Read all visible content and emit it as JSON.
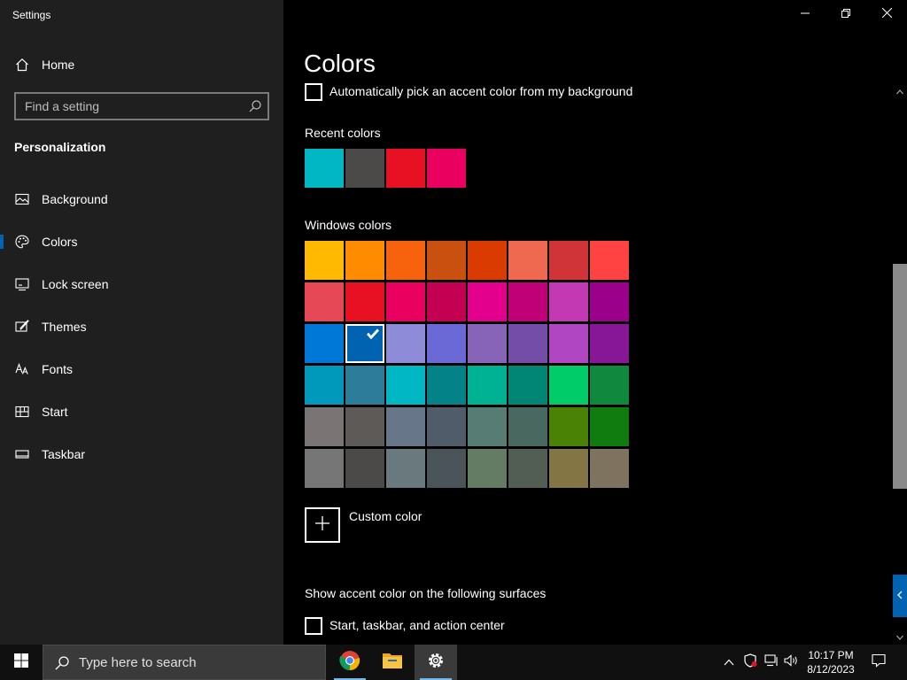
{
  "window": {
    "title": "Settings",
    "minimize_label": "Minimize",
    "restore_label": "Restore",
    "close_label": "Close"
  },
  "sidebar": {
    "home": "Home",
    "search_placeholder": "Find a setting",
    "section": "Personalization",
    "items": [
      {
        "label": "Background",
        "icon": "picture-icon"
      },
      {
        "label": "Colors",
        "icon": "palette-icon",
        "active": true
      },
      {
        "label": "Lock screen",
        "icon": "lock-screen-icon"
      },
      {
        "label": "Themes",
        "icon": "brush-icon"
      },
      {
        "label": "Fonts",
        "icon": "font-icon"
      },
      {
        "label": "Start",
        "icon": "start-icon"
      },
      {
        "label": "Taskbar",
        "icon": "taskbar-icon"
      }
    ]
  },
  "content": {
    "title": "Colors",
    "auto_pick_label": "Automatically pick an accent color from my background",
    "recent_heading": "Recent colors",
    "recent_colors": [
      "#00b7c3",
      "#4c4a48",
      "#e81123",
      "#ea005e"
    ],
    "windows_heading": "Windows colors",
    "windows_colors": [
      [
        "#ffb900",
        "#ff8c00",
        "#f7630c",
        "#ca5010",
        "#da3b01",
        "#ef6950",
        "#d13438",
        "#ff4343"
      ],
      [
        "#e74856",
        "#e81123",
        "#ea005e",
        "#c30052",
        "#e3008c",
        "#bf0077",
        "#c239b3",
        "#9a0089"
      ],
      [
        "#0078d7",
        "#0063b1",
        "#8e8cd8",
        "#6b69d6",
        "#8764b8",
        "#744da9",
        "#b146c2",
        "#881798"
      ],
      [
        "#0099bc",
        "#2d7d9a",
        "#00b7c3",
        "#038387",
        "#00b294",
        "#018574",
        "#00cc6a",
        "#10893e"
      ],
      [
        "#7a7574",
        "#5d5a58",
        "#68768a",
        "#515c6b",
        "#567c73",
        "#486860",
        "#498205",
        "#107c10"
      ],
      [
        "#767676",
        "#4c4a48",
        "#69797e",
        "#4a5459",
        "#647c64",
        "#525e54",
        "#847545",
        "#7e735f"
      ]
    ],
    "selected_color": "#0063b1",
    "custom_color_label": "Custom color",
    "surfaces_heading": "Show accent color on the following surfaces",
    "start_taskbar_label": "Start, taskbar, and action center"
  },
  "taskbar": {
    "search_placeholder": "Type here to search",
    "apps": [
      "chrome-icon",
      "file-explorer-icon",
      "settings-icon"
    ],
    "time": "10:17 PM",
    "date": "8/12/2023"
  }
}
